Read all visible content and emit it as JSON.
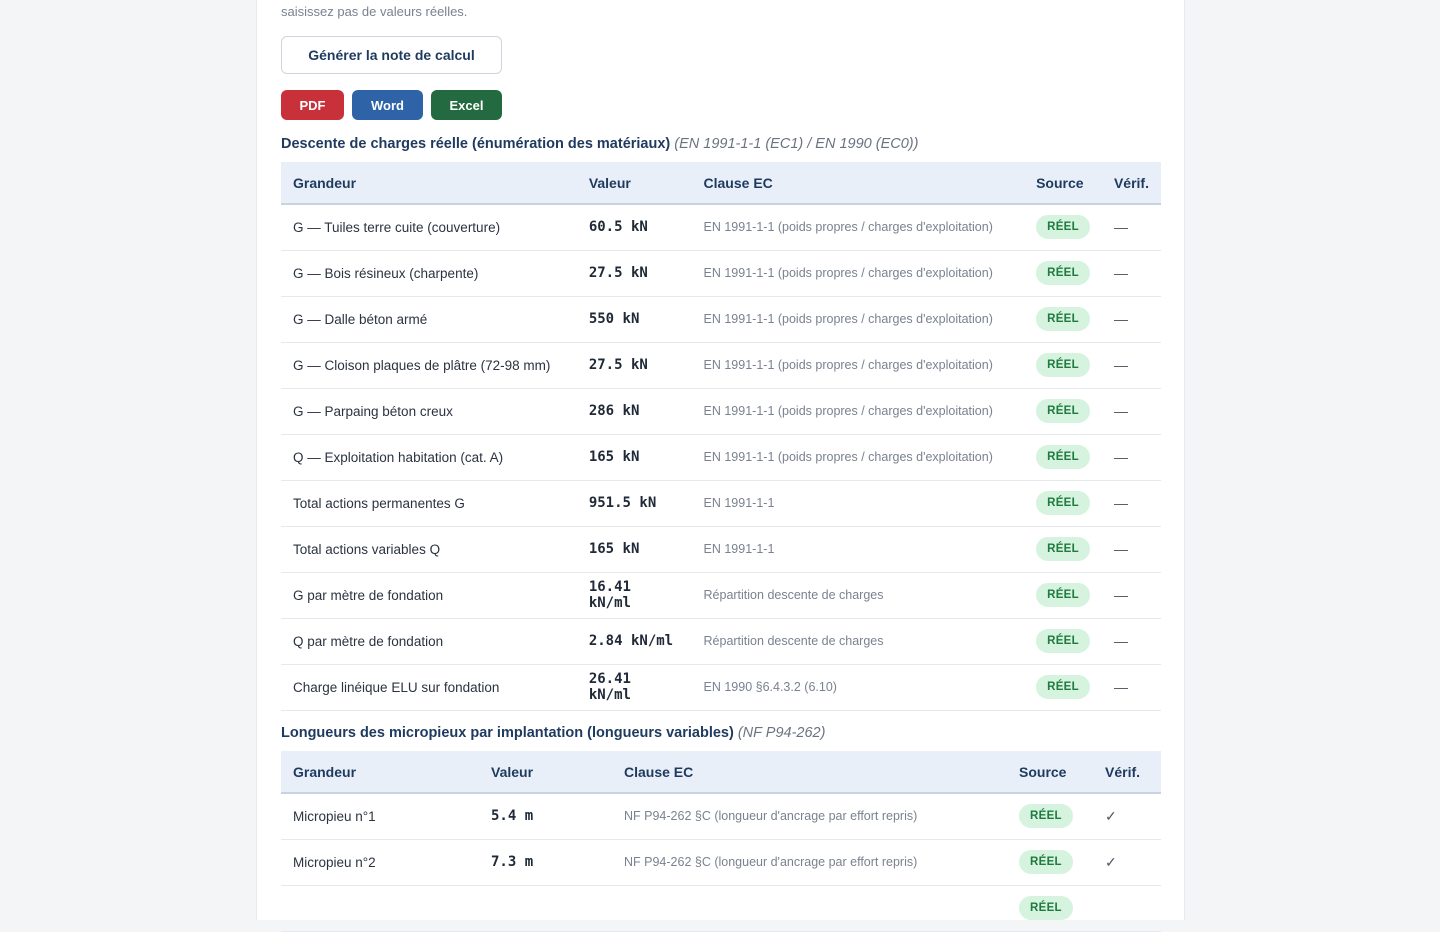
{
  "hint_text": "saisissez pas de valeurs réelles.",
  "generate_button": "Générer la note de calcul",
  "exports": {
    "pdf": {
      "label": "PDF",
      "color": "#c8313a"
    },
    "word": {
      "label": "Word",
      "color": "#2e63a8"
    },
    "excel": {
      "label": "Excel",
      "color": "#236a40"
    }
  },
  "section1": {
    "title": "Descente de charges réelle (énumération des matériaux)",
    "ref": "(EN 1991-1-1 (EC1) / EN 1990 (EC0))",
    "headers": {
      "grandeur": "Grandeur",
      "valeur": "Valeur",
      "clause": "Clause EC",
      "source": "Source",
      "verif": "Vérif."
    },
    "rows": [
      {
        "name": "G — Tuiles terre cuite (couverture)",
        "value": "60.5 kN",
        "clause": "EN 1991-1-1 (poids propres / charges d'exploitation)",
        "source": "RÉEL",
        "verif": "—"
      },
      {
        "name": "G — Bois résineux (charpente)",
        "value": "27.5 kN",
        "clause": "EN 1991-1-1 (poids propres / charges d'exploitation)",
        "source": "RÉEL",
        "verif": "—"
      },
      {
        "name": "G — Dalle béton armé",
        "value": "550 kN",
        "clause": "EN 1991-1-1 (poids propres / charges d'exploitation)",
        "source": "RÉEL",
        "verif": "—"
      },
      {
        "name": "G — Cloison plaques de plâtre (72-98 mm)",
        "value": "27.5 kN",
        "clause": "EN 1991-1-1 (poids propres / charges d'exploitation)",
        "source": "RÉEL",
        "verif": "—"
      },
      {
        "name": "G — Parpaing béton creux",
        "value": "286 kN",
        "clause": "EN 1991-1-1 (poids propres / charges d'exploitation)",
        "source": "RÉEL",
        "verif": "—"
      },
      {
        "name": "Q — Exploitation habitation (cat. A)",
        "value": "165 kN",
        "clause": "EN 1991-1-1 (poids propres / charges d'exploitation)",
        "source": "RÉEL",
        "verif": "—"
      },
      {
        "name": "Total actions permanentes G",
        "value": "951.5 kN",
        "clause": "EN 1991-1-1",
        "source": "RÉEL",
        "verif": "—"
      },
      {
        "name": "Total actions variables Q",
        "value": "165 kN",
        "clause": "EN 1991-1-1",
        "source": "RÉEL",
        "verif": "—"
      },
      {
        "name": "G par mètre de fondation",
        "value": "16.41 kN/ml",
        "clause": "Répartition descente de charges",
        "source": "RÉEL",
        "verif": "—"
      },
      {
        "name": "Q par mètre de fondation",
        "value": "2.84 kN/ml",
        "clause": "Répartition descente de charges",
        "source": "RÉEL",
        "verif": "—"
      },
      {
        "name": "Charge linéique ELU sur fondation",
        "value": "26.41 kN/ml",
        "clause": "EN 1990 §6.4.3.2 (6.10)",
        "source": "RÉEL",
        "verif": "—"
      }
    ]
  },
  "section2": {
    "title": "Longueurs des micropieux par implantation (longueurs variables)",
    "ref": "(NF P94-262)",
    "headers": {
      "grandeur": "Grandeur",
      "valeur": "Valeur",
      "clause": "Clause EC",
      "source": "Source",
      "verif": "Vérif."
    },
    "rows": [
      {
        "name": "Micropieu n°1",
        "value": "5.4 m",
        "clause": "NF P94-262 §C (longueur d'ancrage par effort repris)",
        "source": "RÉEL",
        "verif": "✓"
      },
      {
        "name": "Micropieu n°2",
        "value": "7.3 m",
        "clause": "NF P94-262 §C (longueur d'ancrage par effort repris)",
        "source": "RÉEL",
        "verif": "✓"
      },
      {
        "name": "",
        "value": "",
        "clause": "",
        "source": "RÉEL",
        "verif": ""
      }
    ]
  }
}
